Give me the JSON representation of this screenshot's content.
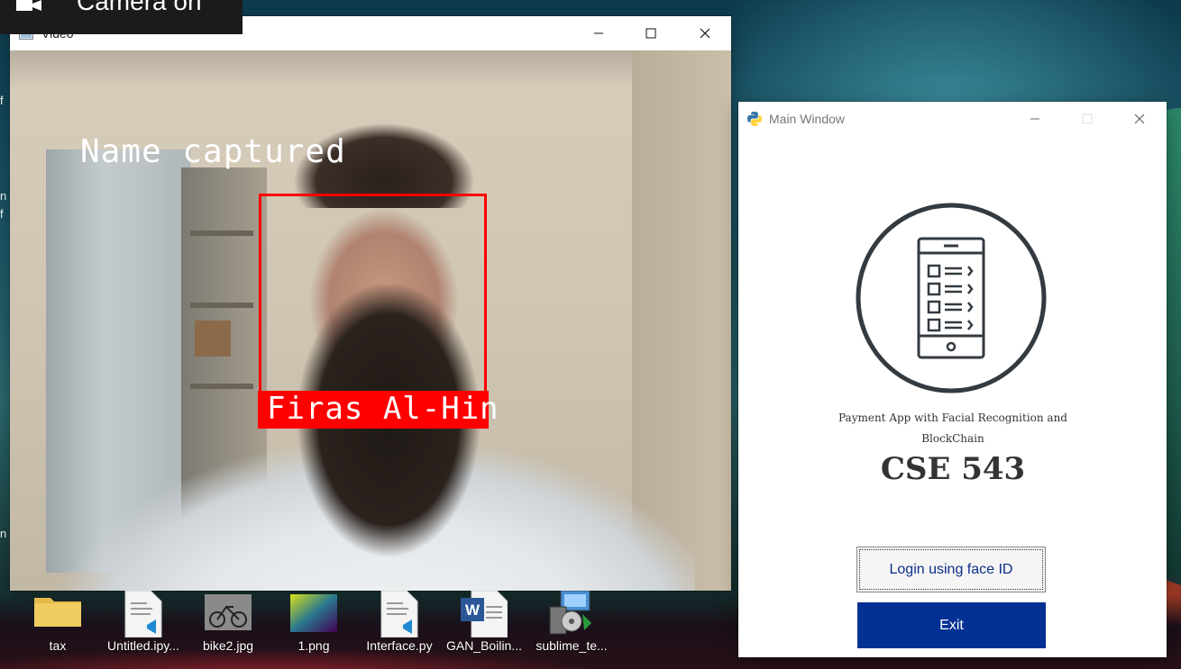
{
  "toast": {
    "text": "Camera on",
    "icon": "camera-icon"
  },
  "video_window": {
    "title": "Video",
    "overlay_status": "Name captured",
    "face_label": "Firas Al-Hin",
    "box_color": "#ff0000"
  },
  "main_window": {
    "title": "Main Window",
    "subtitle_line1": "Payment App with Facial Recognition and",
    "subtitle_line2": "BlockChain",
    "course": "CSE 543",
    "login_label": "Login using face ID",
    "exit_label": "Exit",
    "exit_color": "#033193",
    "login_text_color": "#0b2f86",
    "logo_icon": "mobile-checklist-icon"
  },
  "desktop_icons": [
    {
      "label": "tax",
      "icon": "folder-icon"
    },
    {
      "label": "Untitled.ipy...",
      "icon": "vscode-file-icon"
    },
    {
      "label": "bike2.jpg",
      "icon": "image-file-icon"
    },
    {
      "label": "1.png",
      "icon": "image-file-icon"
    },
    {
      "label": "Interface.py",
      "icon": "vscode-file-icon"
    },
    {
      "label": "GAN_Boilin...",
      "icon": "word-document-icon"
    },
    {
      "label": "sublime_te...",
      "icon": "installer-icon"
    }
  ]
}
